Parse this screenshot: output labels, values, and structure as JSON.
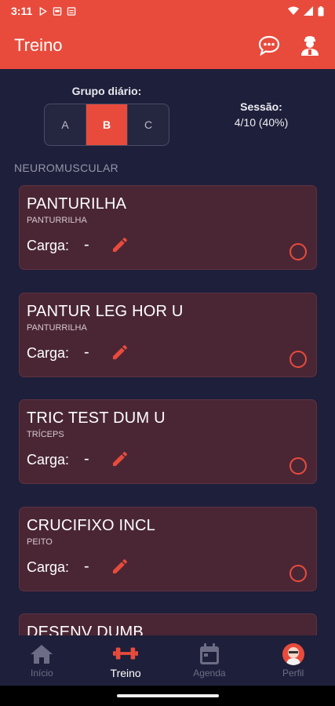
{
  "status_bar": {
    "time": "3:11"
  },
  "app_bar": {
    "title": "Treino",
    "chat_icon": "chat-bubble-icon",
    "trainer_icon": "trainer-icon"
  },
  "grupo": {
    "label": "Grupo diário:",
    "options": [
      "A",
      "B",
      "C"
    ],
    "selected": "B"
  },
  "sessao": {
    "label": "Sessão:",
    "value": "4/10 (40%)"
  },
  "section_title": "NEUROMUSCULAR",
  "exercises": [
    {
      "name": "PANTURILHA",
      "muscle": "PANTURRILHA",
      "carga_label": "Carga:",
      "carga": "-"
    },
    {
      "name": "PANTUR LEG HOR U",
      "muscle": "PANTURRILHA",
      "carga_label": "Carga:",
      "carga": "-"
    },
    {
      "name": "TRIC TEST DUM U",
      "muscle": "TRÍCEPS",
      "carga_label": "Carga:",
      "carga": "-"
    },
    {
      "name": "CRUCIFIXO INCL",
      "muscle": "PEITO",
      "carga_label": "Carga:",
      "carga": "-"
    },
    {
      "name": "DESENV DUMB",
      "muscle": "",
      "carga_label": "",
      "carga": ""
    }
  ],
  "nav": {
    "items": [
      {
        "label": "Início",
        "icon": "home-icon"
      },
      {
        "label": "Treino",
        "icon": "dumbbell-icon"
      },
      {
        "label": "Agenda",
        "icon": "calendar-icon"
      },
      {
        "label": "Perfil",
        "icon": "avatar"
      }
    ],
    "active": "Treino"
  },
  "colors": {
    "accent": "#e84b3c",
    "background": "#1e1f3a",
    "card": "#4a2635"
  }
}
